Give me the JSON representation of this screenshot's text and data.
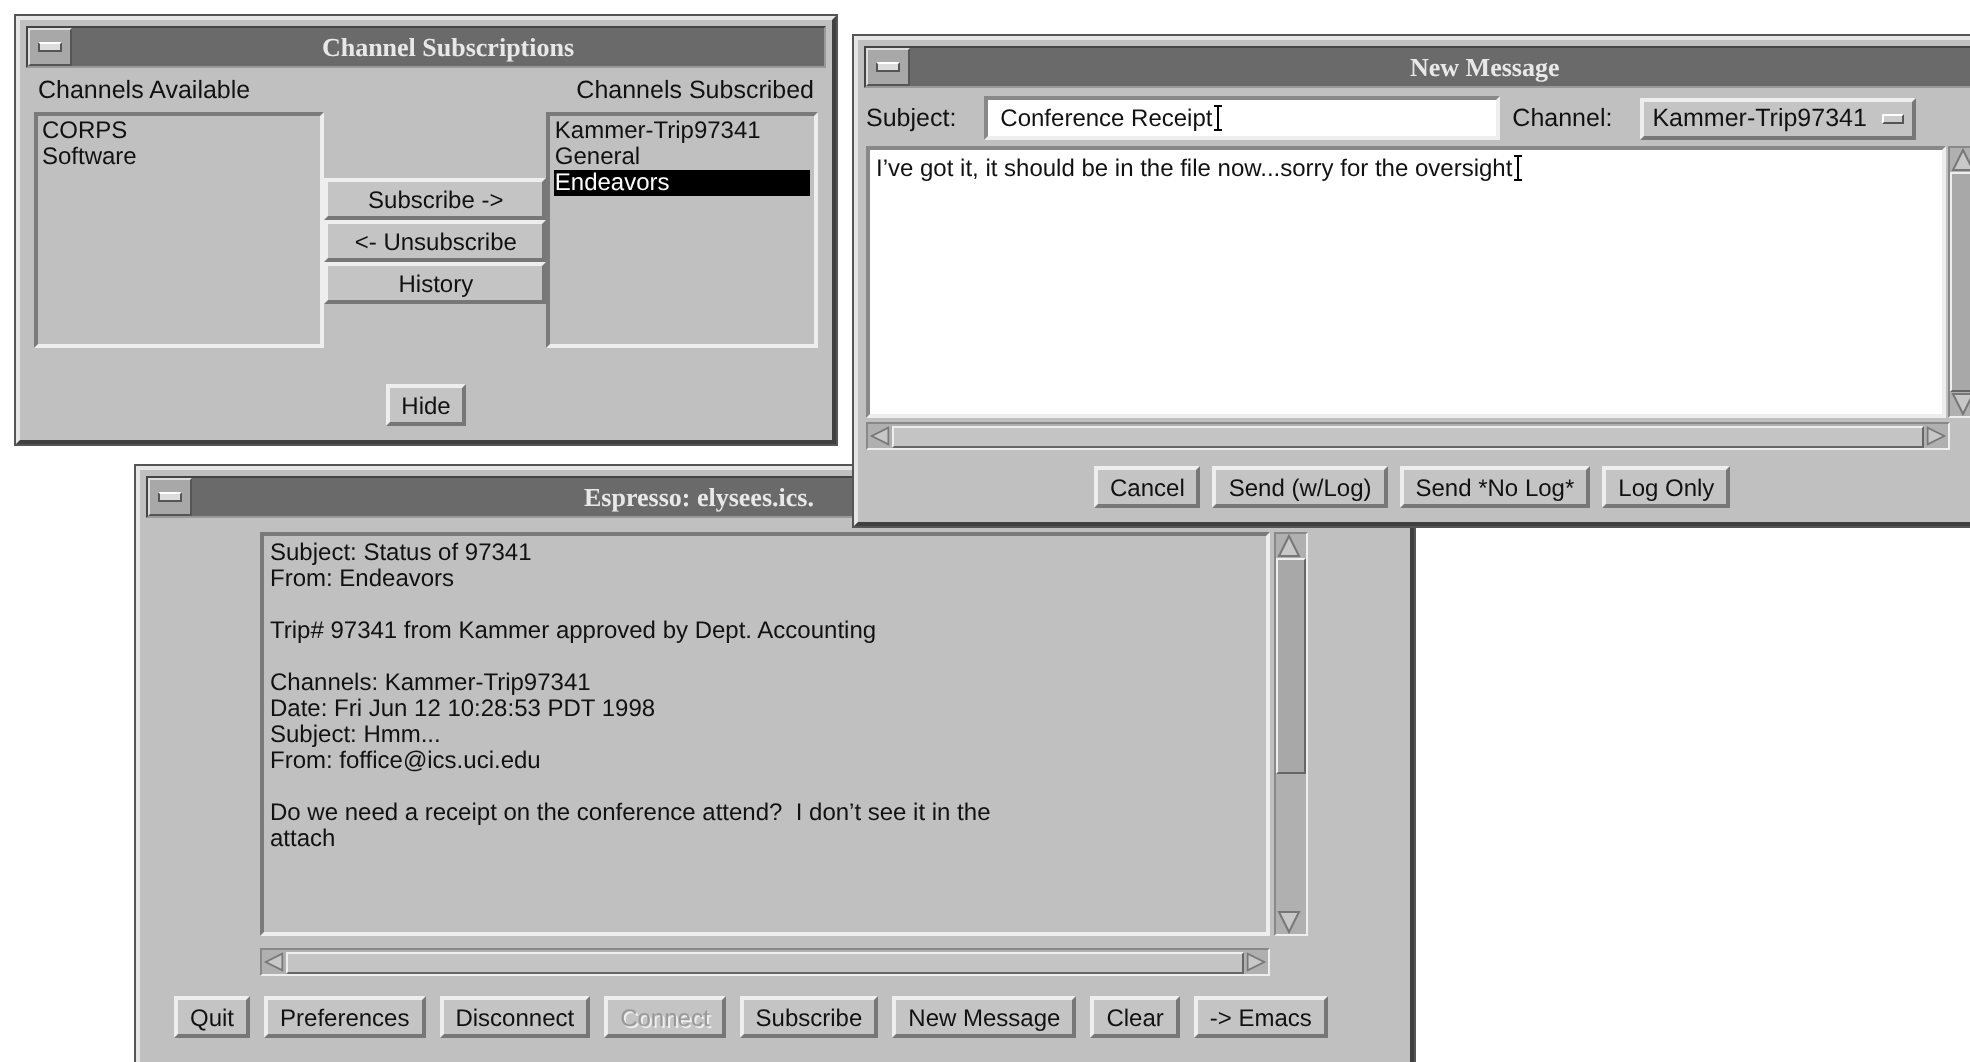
{
  "channel_subscriptions": {
    "title": "Channel Subscriptions",
    "available_label": "Channels Available",
    "subscribed_label": "Channels Subscribed",
    "available": [
      {
        "label": "CORPS"
      },
      {
        "label": "Software"
      }
    ],
    "subscribed": [
      {
        "label": "Kammer-Trip97341",
        "selected": false
      },
      {
        "label": "General",
        "selected": false
      },
      {
        "label": "Endeavors",
        "selected": true
      }
    ],
    "buttons": [
      "Subscribe ->",
      "<- Unsubscribe",
      "History"
    ],
    "hide_button": "Hide"
  },
  "new_message": {
    "title": "New Message",
    "subject_label": "Subject:",
    "subject_value": "Conference Receipt",
    "channel_label": "Channel:",
    "channel_value": "Kammer-Trip97341",
    "body": "I’ve got it, it should be in the file now...sorry for the oversight",
    "buttons": [
      "Cancel",
      "Send (w/Log)",
      "Send *No Log*",
      "Log Only"
    ]
  },
  "espresso": {
    "title": "Espresso: elysees.ics.",
    "blocks": [
      {
        "kind": "paragraph",
        "lines": [
          "Subject: Status of 97341",
          "From: Endeavors"
        ]
      },
      {
        "kind": "paragraph",
        "lines": [
          "Trip# 97341 from Kammer approved by Dept. Accounting"
        ]
      },
      {
        "kind": "section",
        "lines": [
          "Channels: Kammer-Trip97341",
          "Date: Fri Jun 12 10:28:53 PDT 1998",
          "Subject: Hmm...",
          "From: foffice@ics.uci.edu"
        ]
      },
      {
        "kind": "paragraph",
        "lines": [
          "Do we need a receipt on the conference attend?  I don’t see it in the",
          "attach"
        ]
      }
    ],
    "buttons": [
      {
        "label": "Quit",
        "disabled": false
      },
      {
        "label": "Preferences",
        "disabled": false
      },
      {
        "label": "Disconnect",
        "disabled": false
      },
      {
        "label": "Connect",
        "disabled": true
      },
      {
        "label": "Subscribe",
        "disabled": false
      },
      {
        "label": "New Message",
        "disabled": false
      },
      {
        "label": "Clear",
        "disabled": false
      },
      {
        "label": "-> Emacs",
        "disabled": false
      }
    ]
  }
}
